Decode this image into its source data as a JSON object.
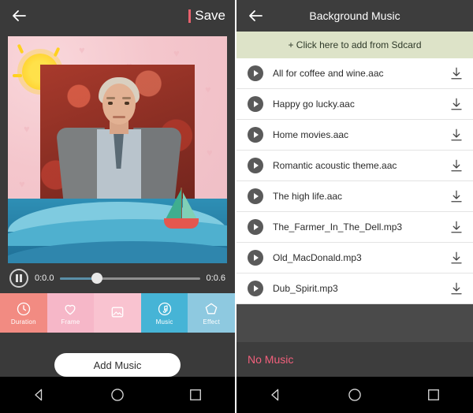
{
  "left": {
    "topbar": {
      "back_icon": "back-arrow-icon",
      "save_label": "Save"
    },
    "canvas": {
      "sun_icon": "sun-decoration",
      "boat_icon": "sailboat-decoration",
      "photo_alt": "portrait-photo"
    },
    "player": {
      "pause_icon": "pause-icon",
      "current_time": "0:0.0",
      "total_time": "0:0.6",
      "progress_percent": 26
    },
    "tabs": [
      {
        "label": "Duration",
        "icon": "clock-icon",
        "color": "#f28b82",
        "active": false
      },
      {
        "label": "Frame",
        "icon": "heart-icon",
        "color": "#f6b7c8",
        "active": false
      },
      {
        "label": "",
        "icon": "image-icon",
        "color": "#f9c3d0",
        "active": false
      },
      {
        "label": "Music",
        "icon": "music-note-icon",
        "color": "#46b4d6",
        "active": true
      },
      {
        "label": "Effect",
        "icon": "pentagon-icon",
        "color": "#8ec9e0",
        "active": false
      }
    ],
    "add_music_label": "Add Music",
    "navbar": [
      {
        "icon": "back-triangle-icon"
      },
      {
        "icon": "home-circle-icon"
      },
      {
        "icon": "recents-square-icon"
      }
    ]
  },
  "right": {
    "topbar": {
      "back_icon": "back-arrow-icon",
      "title": "Background Music"
    },
    "sdcard_label": "+ Click here to add from Sdcard",
    "tracks": [
      {
        "name": "All for coffee and wine.aac",
        "play_icon": "play-circle-icon",
        "download_icon": "download-icon"
      },
      {
        "name": "Happy go lucky.aac",
        "play_icon": "play-circle-icon",
        "download_icon": "download-icon"
      },
      {
        "name": "Home movies.aac",
        "play_icon": "play-circle-icon",
        "download_icon": "download-icon"
      },
      {
        "name": "Romantic acoustic theme.aac",
        "play_icon": "play-circle-icon",
        "download_icon": "download-icon"
      },
      {
        "name": "The high life.aac",
        "play_icon": "play-circle-icon",
        "download_icon": "download-icon"
      },
      {
        "name": "The_Farmer_In_The_Dell.mp3",
        "play_icon": "play-circle-icon",
        "download_icon": "download-icon"
      },
      {
        "name": "Old_MacDonald.mp3",
        "play_icon": "play-circle-icon",
        "download_icon": "download-icon"
      },
      {
        "name": "Dub_Spirit.mp3",
        "play_icon": "play-circle-icon",
        "download_icon": "download-icon"
      }
    ],
    "status_label": "No Music",
    "navbar": [
      {
        "icon": "back-triangle-icon"
      },
      {
        "icon": "home-circle-icon"
      },
      {
        "icon": "recents-square-icon"
      }
    ]
  },
  "colors": {
    "accent_pink": "#f2607c",
    "save_bar": "#e8616d",
    "sdcard_bg": "#dde3c8",
    "music_tab": "#46b4d6"
  }
}
